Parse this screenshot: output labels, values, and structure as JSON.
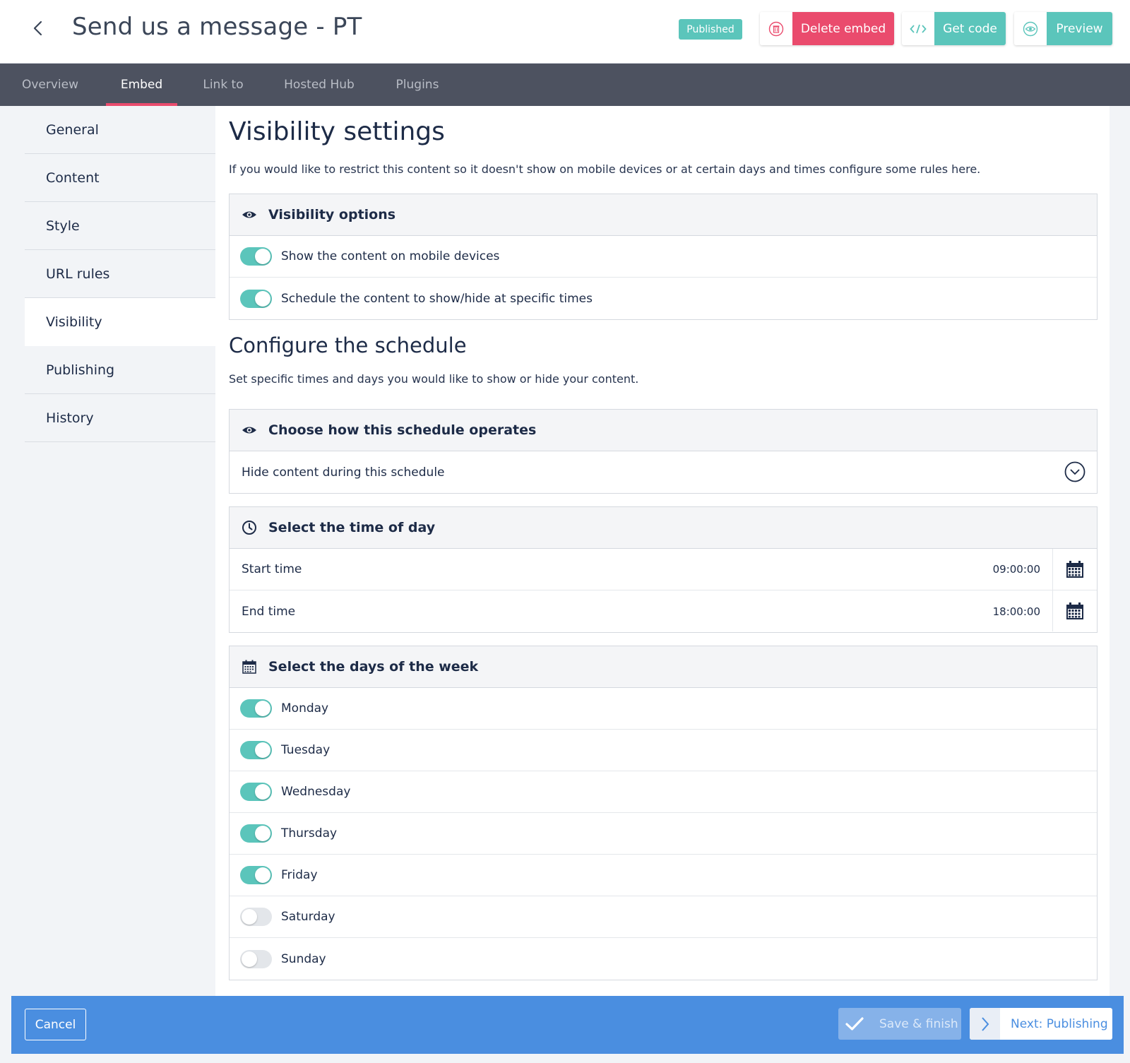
{
  "header": {
    "title": "Send us a message - PT",
    "status_badge": "Published",
    "delete_label": "Delete embed",
    "get_code_label": "Get code",
    "preview_label": "Preview"
  },
  "nav": {
    "tabs": [
      {
        "label": "Overview"
      },
      {
        "label": "Embed",
        "active": true
      },
      {
        "label": "Link to"
      },
      {
        "label": "Hosted Hub"
      },
      {
        "label": "Plugins"
      }
    ]
  },
  "sidebar": {
    "items": [
      {
        "label": "General"
      },
      {
        "label": "Content"
      },
      {
        "label": "Style"
      },
      {
        "label": "URL rules"
      },
      {
        "label": "Visibility",
        "active": true
      },
      {
        "label": "Publishing"
      },
      {
        "label": "History"
      }
    ]
  },
  "visibility": {
    "title": "Visibility settings",
    "description": "If you would like to restrict this content so it doesn't show on mobile devices or at certain days and times configure some rules here.",
    "options_title": "Visibility options",
    "options": [
      {
        "label": "Show the content on mobile devices",
        "on": true
      },
      {
        "label": "Schedule the content to show/hide at specific times",
        "on": true
      }
    ]
  },
  "schedule": {
    "title": "Configure the schedule",
    "description": "Set specific times and days you would like to show or hide your content.",
    "operation_title": "Choose how this schedule operates",
    "operation_value": "Hide content during this schedule",
    "time_title": "Select the time of day",
    "start_label": "Start time",
    "start_value": "09:00:00",
    "end_label": "End time",
    "end_value": "18:00:00",
    "days_title": "Select the days of the week",
    "days": [
      {
        "label": "Monday",
        "on": true
      },
      {
        "label": "Tuesday",
        "on": true
      },
      {
        "label": "Wednesday",
        "on": true
      },
      {
        "label": "Thursday",
        "on": true
      },
      {
        "label": "Friday",
        "on": true
      },
      {
        "label": "Saturday",
        "on": false
      },
      {
        "label": "Sunday",
        "on": false
      }
    ]
  },
  "footer": {
    "cancel_label": "Cancel",
    "save_label": "Save & finish",
    "next_label": "Next: Publishing"
  },
  "colors": {
    "accent_teal": "#5bc5bb",
    "danger_pink": "#ea4b6d",
    "nav_dark": "#4d5260",
    "footer_blue": "#4a8ee0",
    "text_navy": "#1d2b47"
  }
}
